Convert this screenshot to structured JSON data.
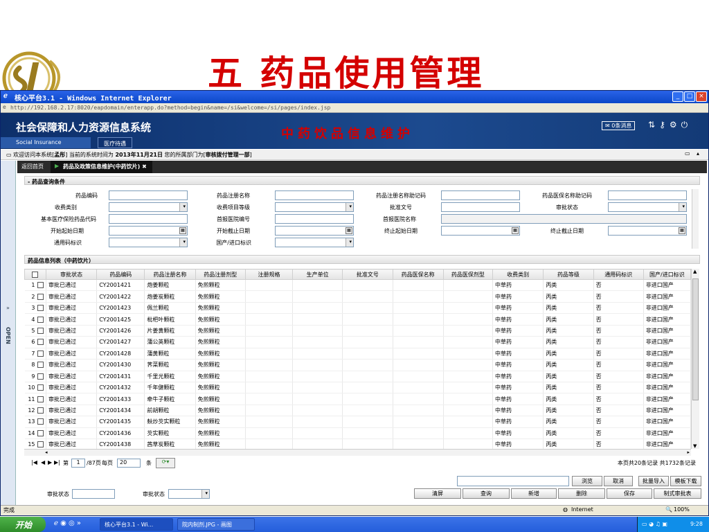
{
  "slide": {
    "title": "五  药品使用管理",
    "logo_text": "SI"
  },
  "ie": {
    "window_title": "核心平台3.1 - Windows Internet Explorer",
    "address": "http://192.168.2.17:8020/eapdomain/enterapp.do?method=begin&name=/si&welcome=/si/pages/index.jsp",
    "status_left": "完成",
    "status_zone": "Internet",
    "zoom": "100%"
  },
  "banner": {
    "system_name": "社会保障和人力资源信息系统",
    "system_name_en": "Social Insurance",
    "tab_medical": "医疗待遇",
    "module_title": "中药饮品信息维护",
    "messages": "0条消息"
  },
  "infobar": {
    "prefix": "欢迎访问本系统[",
    "user": "孟彤",
    "mid": "] 当前的系统时间为",
    "date": "2013年11月21日",
    "mid2": "您的所属部门为[",
    "dept": "审核拨付管理一部",
    "suffix": "]"
  },
  "tabs": {
    "back": "返回首页",
    "current": "药品及政策信息维护(中药饮片)"
  },
  "left_strip": {
    "open": "OPEN"
  },
  "query": {
    "section_title": "药品查询条件",
    "labels": {
      "drug_code": "药品编码",
      "drug_reg_name": "药品注册名称",
      "reg_name_mnemonic": "药品注册名称助记码",
      "med_ins_name_mnemonic": "药品医保名称助记码",
      "fee_category": "收费类别",
      "fee_item_grade": "收费项目等级",
      "approval_no": "批准文号",
      "approval_status": "审批状态",
      "basic_ins_code": "基本医疗保险药品代码",
      "first_hospital_no": "首报医院编号",
      "first_hospital_name": "首报医院名称",
      "start_begin_date": "开始起始日期",
      "start_end_date": "开始截止日期",
      "end_begin_date": "终止起始日期",
      "end_end_date": "终止截止日期",
      "generic_flag": "通用码标识",
      "domestic_import_flag": "国产/进口标识"
    }
  },
  "list": {
    "section_title": "药品信息列表（中药饮片）",
    "headers": [
      "",
      "审批状态",
      "药品编码",
      "药品注册名称",
      "药品注册剂型",
      "注册规格",
      "生产单位",
      "批准文号",
      "药品医保名称",
      "药品医保剂型",
      "收费类别",
      "药品等级",
      "通用码标识",
      "国产/进口标识"
    ],
    "rows": [
      {
        "n": "1",
        "status": "审批已通过",
        "code": "CY2001421",
        "name": "炮姜颗粒",
        "form": "免煎颗粒",
        "fee": "中草药",
        "grade": "丙类",
        "generic": "否",
        "origin": "非进口国产"
      },
      {
        "n": "2",
        "status": "审批已通过",
        "code": "CY2001422",
        "name": "炮姜炭颗粒",
        "form": "免煎颗粒",
        "fee": "中草药",
        "grade": "丙类",
        "generic": "否",
        "origin": "非进口国产"
      },
      {
        "n": "3",
        "status": "审批已通过",
        "code": "CY2001423",
        "name": "佩兰颗粒",
        "form": "免煎颗粒",
        "fee": "中草药",
        "grade": "丙类",
        "generic": "否",
        "origin": "非进口国产"
      },
      {
        "n": "4",
        "status": "审批已通过",
        "code": "CY2001425",
        "name": "枇杷叶颗粒",
        "form": "免煎颗粒",
        "fee": "中草药",
        "grade": "丙类",
        "generic": "否",
        "origin": "非进口国产"
      },
      {
        "n": "5",
        "status": "审批已通过",
        "code": "CY2001426",
        "name": "片姜黄颗粒",
        "form": "免煎颗粒",
        "fee": "中草药",
        "grade": "丙类",
        "generic": "否",
        "origin": "非进口国产"
      },
      {
        "n": "6",
        "status": "审批已通过",
        "code": "CY2001427",
        "name": "蒲公英颗粒",
        "form": "免煎颗粒",
        "fee": "中草药",
        "grade": "丙类",
        "generic": "否",
        "origin": "非进口国产"
      },
      {
        "n": "7",
        "status": "审批已通过",
        "code": "CY2001428",
        "name": "蒲黄颗粒",
        "form": "免煎颗粒",
        "fee": "中草药",
        "grade": "丙类",
        "generic": "否",
        "origin": "非进口国产"
      },
      {
        "n": "8",
        "status": "审批已通过",
        "code": "CY2001430",
        "name": "荠菜颗粒",
        "form": "免煎颗粒",
        "fee": "中草药",
        "grade": "丙类",
        "generic": "否",
        "origin": "非进口国产"
      },
      {
        "n": "9",
        "status": "审批已通过",
        "code": "CY2001431",
        "name": "千里光颗粒",
        "form": "免煎颗粒",
        "fee": "中草药",
        "grade": "丙类",
        "generic": "否",
        "origin": "非进口国产"
      },
      {
        "n": "10",
        "status": "审批已通过",
        "code": "CY2001432",
        "name": "千年健颗粒",
        "form": "免煎颗粒",
        "fee": "中草药",
        "grade": "丙类",
        "generic": "否",
        "origin": "非进口国产"
      },
      {
        "n": "11",
        "status": "审批已通过",
        "code": "CY2001433",
        "name": "牵牛子颗粒",
        "form": "免煎颗粒",
        "fee": "中草药",
        "grade": "丙类",
        "generic": "否",
        "origin": "非进口国产"
      },
      {
        "n": "12",
        "status": "审批已通过",
        "code": "CY2001434",
        "name": "前胡颗粒",
        "form": "免煎颗粒",
        "fee": "中草药",
        "grade": "丙类",
        "generic": "否",
        "origin": "非进口国产"
      },
      {
        "n": "13",
        "status": "审批已通过",
        "code": "CY2001435",
        "name": "麸炒芡实颗粒",
        "form": "免煎颗粒",
        "fee": "中草药",
        "grade": "丙类",
        "generic": "否",
        "origin": "非进口国产"
      },
      {
        "n": "14",
        "status": "审批已通过",
        "code": "CY2001436",
        "name": "芡实颗粒",
        "form": "免煎颗粒",
        "fee": "中草药",
        "grade": "丙类",
        "generic": "否",
        "origin": "非进口国产"
      },
      {
        "n": "15",
        "status": "审批已通过",
        "code": "CY2001438",
        "name": "茜草炭颗粒",
        "form": "免煎颗粒",
        "fee": "中草药",
        "grade": "丙类",
        "generic": "否",
        "origin": "非进口国产"
      }
    ]
  },
  "pager": {
    "page_label_pre": "第",
    "page": "1",
    "page_label_post": "/87页",
    "per_page_label": "每页",
    "per_page": "20",
    "unit": "条",
    "summary": "本页共20条记录 共1732条记录"
  },
  "actions": {
    "browse": "浏览",
    "cancel": "取消",
    "batch_import": "批量导入",
    "template_download": "模板下载",
    "status_label": "审批状态",
    "status_label2": "审批状态",
    "clear": "清屏",
    "query": "查询",
    "add": "新增",
    "delete": "删除",
    "save": "保存",
    "make_approval": "制式审批表"
  },
  "taskbar": {
    "start": "开始",
    "task1": "核心平台3.1 - Wi...",
    "task2": "院内制剂.JPG - 画图",
    "clock": "9:28"
  }
}
